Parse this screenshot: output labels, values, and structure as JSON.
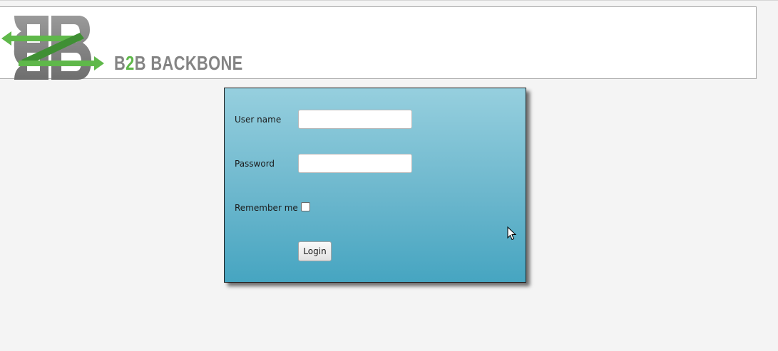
{
  "header": {
    "brand_prefix": "B",
    "brand_accent": "2",
    "brand_suffix": "B BACKBONE",
    "logo_icon": "b2b-backbone-logo-icon"
  },
  "login": {
    "username_label": "User name",
    "username_value": "",
    "password_label": "Password",
    "password_value": "",
    "remember_label": "Remember me",
    "remember_checked": false,
    "login_button": "Login"
  },
  "colors": {
    "page_background": "#f4f4f4",
    "panel_top": "#96cfde",
    "panel_bottom": "#46a5c1",
    "logo_gray": "#848484",
    "logo_green": "#5fb84a"
  }
}
